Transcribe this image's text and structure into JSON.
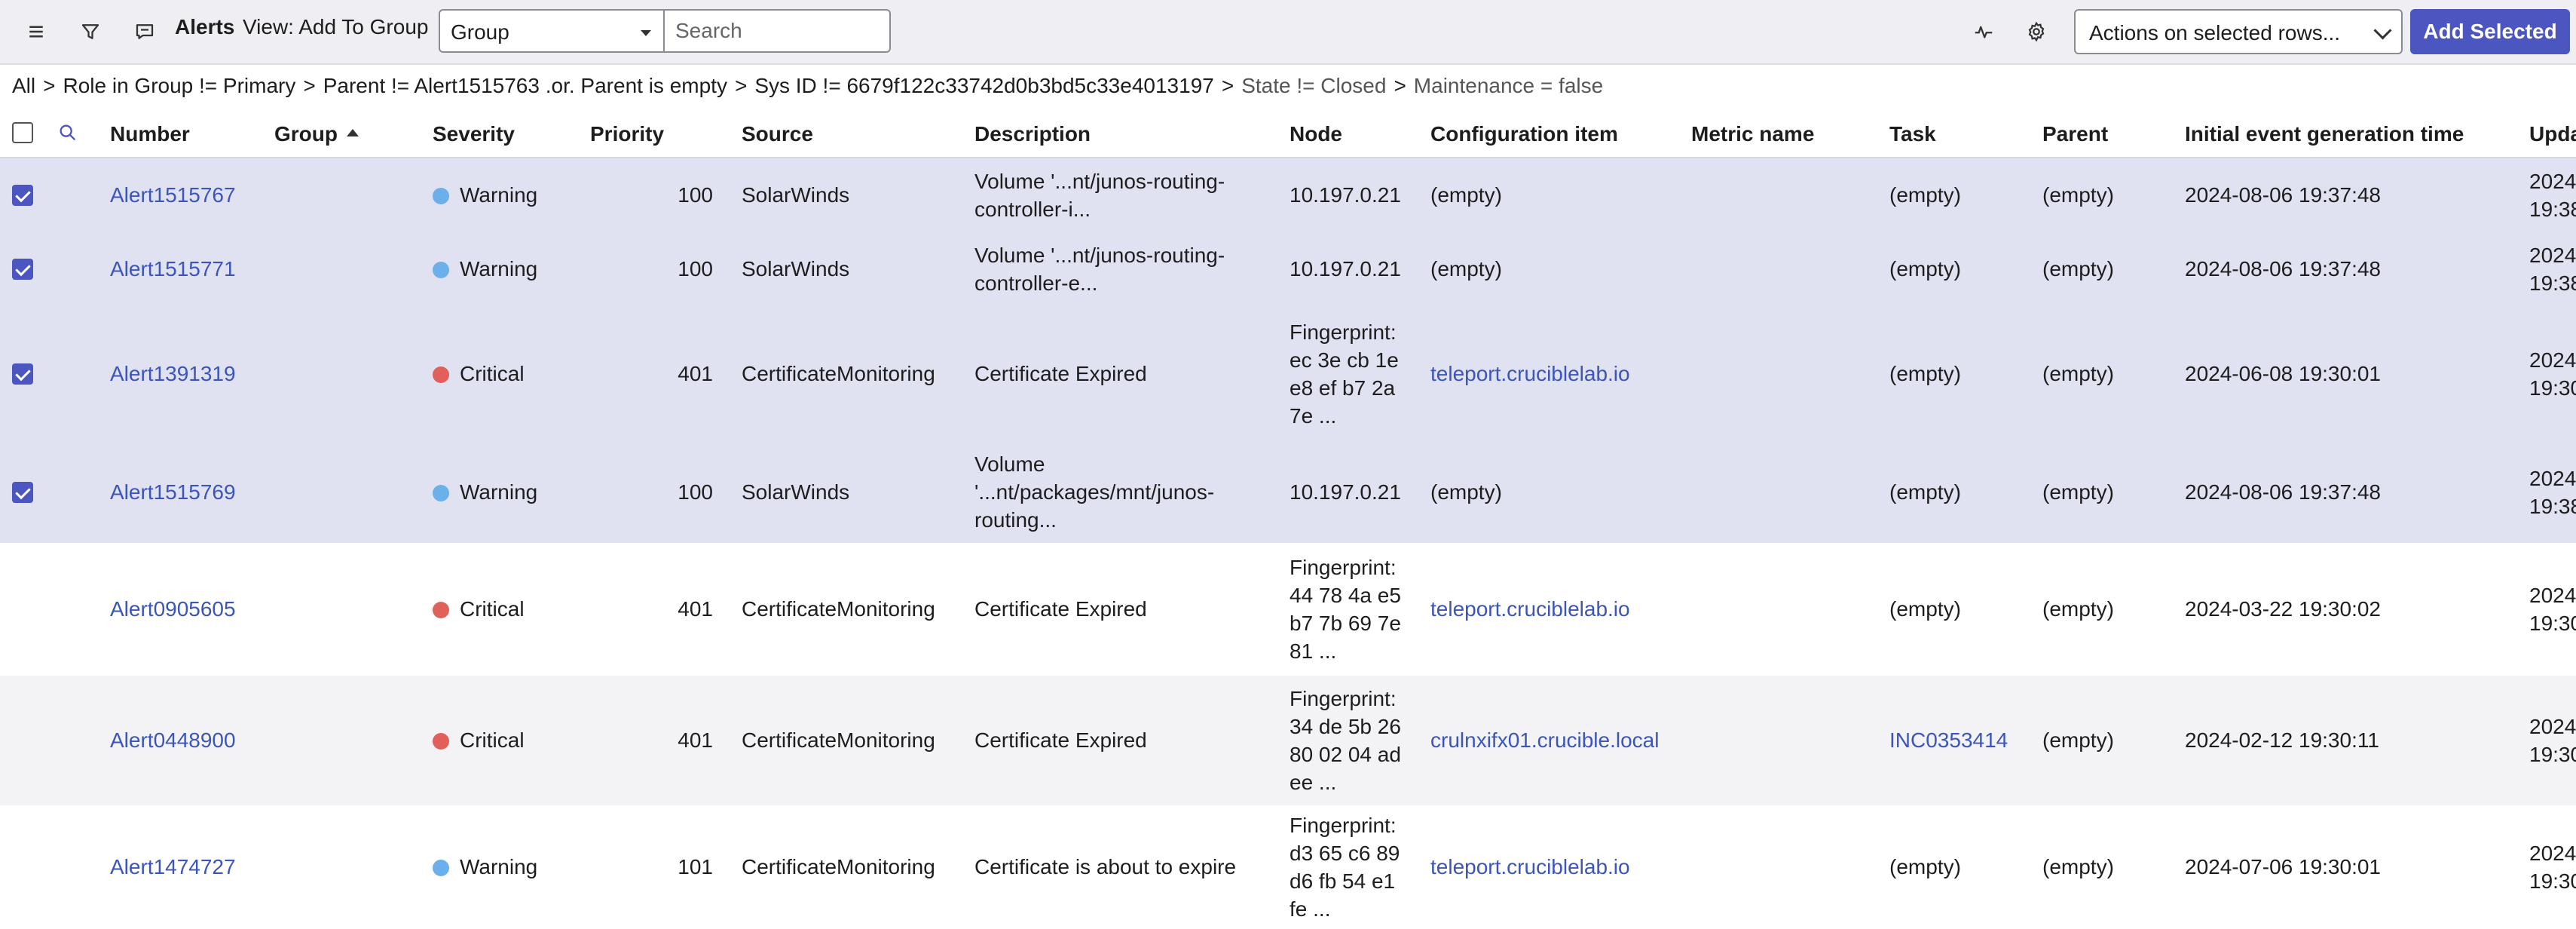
{
  "header": {
    "title": "Alerts",
    "view_label": "View: Add To Group",
    "group_select": "Group",
    "search_placeholder": "Search",
    "actions_select": "Actions on selected rows...",
    "add_selected": "Add Selected",
    "icons": [
      "hamburger-menu-icon",
      "filter-icon",
      "chat-bubble-icon",
      "activity-pulse-icon",
      "gear-icon"
    ]
  },
  "breadcrumb": {
    "items": [
      "All",
      "Role in Group != Primary",
      "Parent != Alert1515763 .or. Parent is empty",
      "Sys ID != 6679f122c33742d0b3bd5c33e4013197",
      "State != Closed",
      "Maintenance = false"
    ],
    "separator": ">"
  },
  "columns": [
    "Number",
    "Group",
    "Severity",
    "Priority",
    "Source",
    "Description",
    "Node",
    "Configuration item",
    "Metric name",
    "Task",
    "Parent",
    "Initial event generation time",
    "Upda"
  ],
  "severity_colors": {
    "Warning": "#6bb0ea",
    "Critical": "#e2605a"
  },
  "rows": [
    {
      "selected": true,
      "number": "Alert1515767",
      "severity": "Warning",
      "priority": "100",
      "source": "SolarWinds",
      "description": [
        "Volume '...nt/junos-routing-",
        "controller-i..."
      ],
      "node": [
        "10.197.0.21"
      ],
      "ci": "(empty)",
      "task": "(empty)",
      "parent": "(empty)",
      "initial_time": "2024-08-06 19:37:48",
      "updated": [
        "2024",
        "19:38"
      ]
    },
    {
      "selected": true,
      "number": "Alert1515771",
      "severity": "Warning",
      "priority": "100",
      "source": "SolarWinds",
      "description": [
        "Volume '...nt/junos-routing-",
        "controller-e..."
      ],
      "node": [
        "10.197.0.21"
      ],
      "ci": "(empty)",
      "task": "(empty)",
      "parent": "(empty)",
      "initial_time": "2024-08-06 19:37:48",
      "updated": [
        "2024",
        "19:38"
      ]
    },
    {
      "selected": true,
      "number": "Alert1391319",
      "severity": "Critical",
      "priority": "401",
      "source": "CertificateMonitoring",
      "description": [
        "Certificate Expired"
      ],
      "node": [
        "Fingerprint:",
        "ec 3e cb 1e",
        "e8 ef b7 2a",
        "7e ..."
      ],
      "ci": "teleport.cruciblelab.io",
      "task": "(empty)",
      "parent": "(empty)",
      "initial_time": "2024-06-08 19:30:01",
      "updated": [
        "2024",
        "19:30"
      ]
    },
    {
      "selected": true,
      "number": "Alert1515769",
      "severity": "Warning",
      "priority": "100",
      "source": "SolarWinds",
      "description": [
        "Volume",
        "'...nt/packages/mnt/junos-",
        "routing..."
      ],
      "node": [
        "10.197.0.21"
      ],
      "ci": "(empty)",
      "task": "(empty)",
      "parent": "(empty)",
      "initial_time": "2024-08-06 19:37:48",
      "updated": [
        "2024",
        "19:38"
      ]
    },
    {
      "selected": false,
      "number": "Alert0905605",
      "severity": "Critical",
      "priority": "401",
      "source": "CertificateMonitoring",
      "description": [
        "Certificate Expired"
      ],
      "node": [
        "Fingerprint:",
        "44 78 4a e5",
        "b7 7b 69 7e",
        "81 ..."
      ],
      "ci": "teleport.cruciblelab.io",
      "task": "(empty)",
      "parent": "(empty)",
      "initial_time": "2024-03-22 19:30:02",
      "updated": [
        "2024",
        "19:30"
      ]
    },
    {
      "selected": false,
      "number": "Alert0448900",
      "severity": "Critical",
      "priority": "401",
      "source": "CertificateMonitoring",
      "description": [
        "Certificate Expired"
      ],
      "node": [
        "Fingerprint:",
        "34 de 5b 26",
        "80 02 04 ad",
        "ee ..."
      ],
      "ci": "crulnxifx01.crucible.local",
      "task": "INC0353414",
      "parent": "(empty)",
      "initial_time": "2024-02-12 19:30:11",
      "updated": [
        "2024",
        "19:30"
      ]
    },
    {
      "selected": false,
      "number": "Alert1474727",
      "severity": "Warning",
      "priority": "101",
      "source": "CertificateMonitoring",
      "description": [
        "Certificate is about to expire"
      ],
      "node": [
        "Fingerprint:",
        "d3 65 c6 89",
        "d6 fb 54 e1",
        "fe ..."
      ],
      "ci": "teleport.cruciblelab.io",
      "task": "(empty)",
      "parent": "(empty)",
      "initial_time": "2024-07-06 19:30:01",
      "updated": [
        "2024",
        "19:30"
      ]
    }
  ]
}
